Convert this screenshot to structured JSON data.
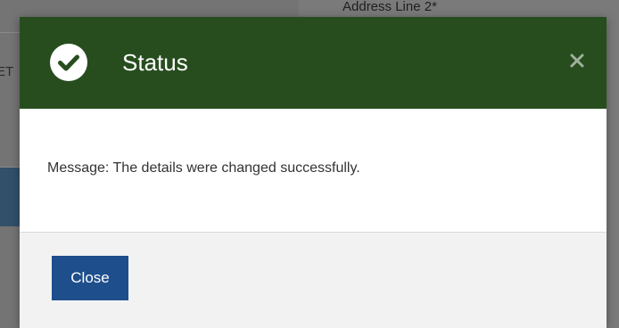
{
  "background": {
    "address_label": "Address Line 2*",
    "left_fragment": "ET"
  },
  "dialog": {
    "title": "Status",
    "status_icon": "check-circle-icon",
    "close_icon": "close-icon",
    "message": "Message: The details were changed successfully.",
    "close_button_label": "Close"
  },
  "colors": {
    "header_bg": "#274d1f",
    "button_bg": "#1f4e8c",
    "footer_bg": "#f2f2f2"
  }
}
